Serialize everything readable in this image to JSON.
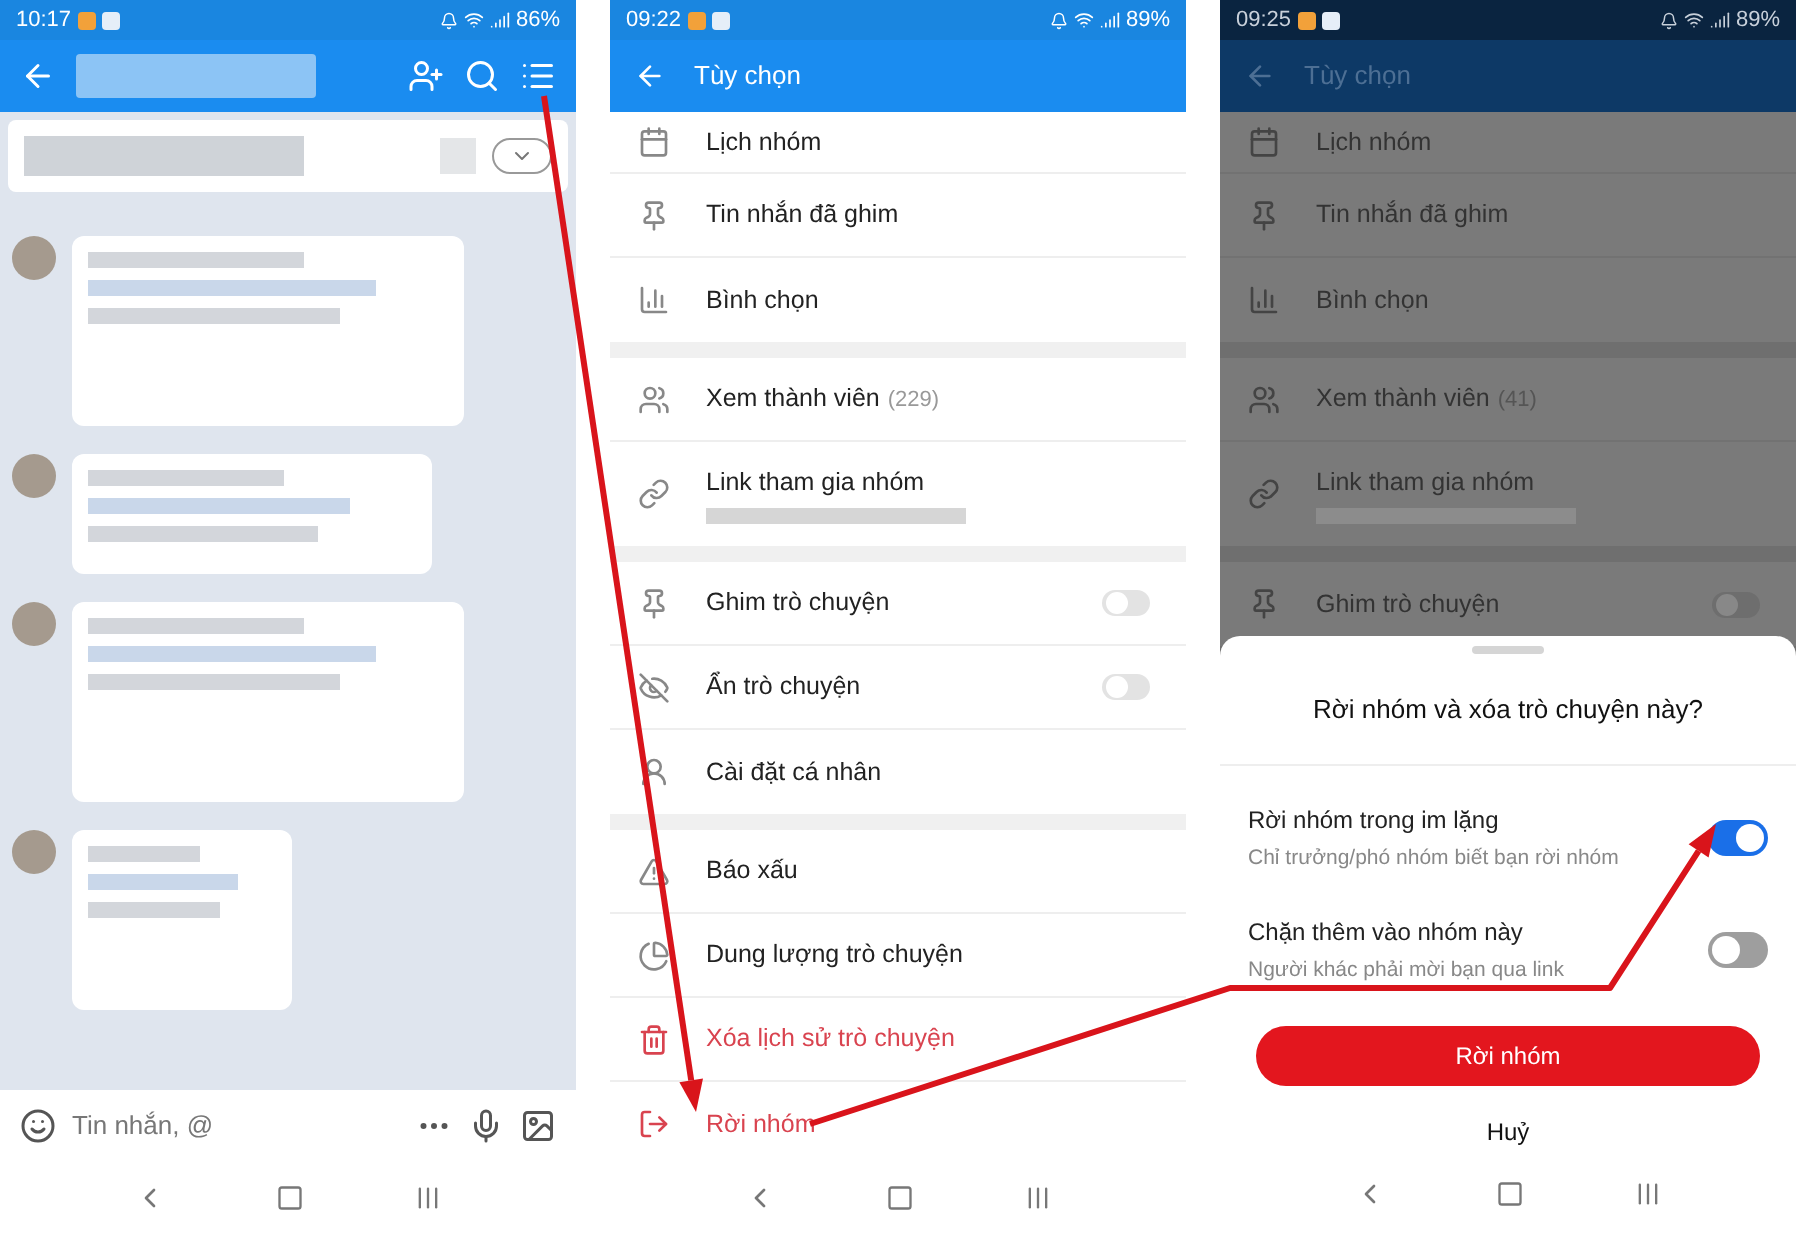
{
  "screens": [
    {
      "kind": "chat",
      "status_bar": {
        "time": "10:17",
        "battery": "86%"
      },
      "composer": {
        "placeholder": "Tin nhắn, @"
      }
    },
    {
      "kind": "options",
      "status_bar": {
        "time": "09:22",
        "battery": "89%"
      },
      "header": {
        "title": "Tùy chọn"
      },
      "sections": [
        [
          {
            "label": "Lịch nhóm",
            "kind": "plain"
          },
          {
            "label": "Tin nhắn đã ghim",
            "kind": "plain"
          },
          {
            "label": "Bình chọn",
            "kind": "plain"
          }
        ],
        [
          {
            "label": "Xem thành viên",
            "count": "(229)",
            "kind": "plain"
          },
          {
            "label": "Link tham gia nhóm",
            "kind": "link"
          }
        ],
        [
          {
            "label": "Ghim trò chuyện",
            "kind": "toggle",
            "on": false
          },
          {
            "label": "Ẩn trò chuyện",
            "kind": "toggle",
            "on": false
          },
          {
            "label": "Cài đặt cá nhân",
            "kind": "plain"
          }
        ],
        [
          {
            "label": "Báo xấu",
            "kind": "plain"
          },
          {
            "label": "Dung lượng trò chuyện",
            "kind": "plain"
          },
          {
            "label": "Xóa lịch sử trò chuyện",
            "kind": "danger"
          },
          {
            "label": "Rời nhóm",
            "kind": "danger"
          }
        ]
      ]
    },
    {
      "kind": "dialog",
      "status_bar": {
        "time": "09:25",
        "battery": "89%"
      },
      "header": {
        "title": "Tùy chọn"
      },
      "sections": [
        [
          {
            "label": "Lịch nhóm",
            "kind": "plain"
          },
          {
            "label": "Tin nhắn đã ghim",
            "kind": "plain"
          },
          {
            "label": "Bình chọn",
            "kind": "plain"
          }
        ],
        [
          {
            "label": "Xem thành viên",
            "count": "(41)",
            "kind": "plain"
          },
          {
            "label": "Link tham gia nhóm",
            "kind": "link"
          }
        ],
        [
          {
            "label": "Ghim trò chuyện",
            "kind": "toggle",
            "on": false
          }
        ]
      ],
      "dialog": {
        "title": "Rời nhóm và xóa trò chuyện này?",
        "options": [
          {
            "title": "Rời nhóm trong im lặng",
            "subtitle": "Chỉ trưởng/phó nhóm biết bạn rời nhóm",
            "on": true
          },
          {
            "title": "Chặn thêm vào nhóm này",
            "subtitle": "Người khác phải mời bạn qua link",
            "on": false
          }
        ],
        "confirm": "Rời nhóm",
        "cancel": "Huỷ"
      }
    }
  ]
}
